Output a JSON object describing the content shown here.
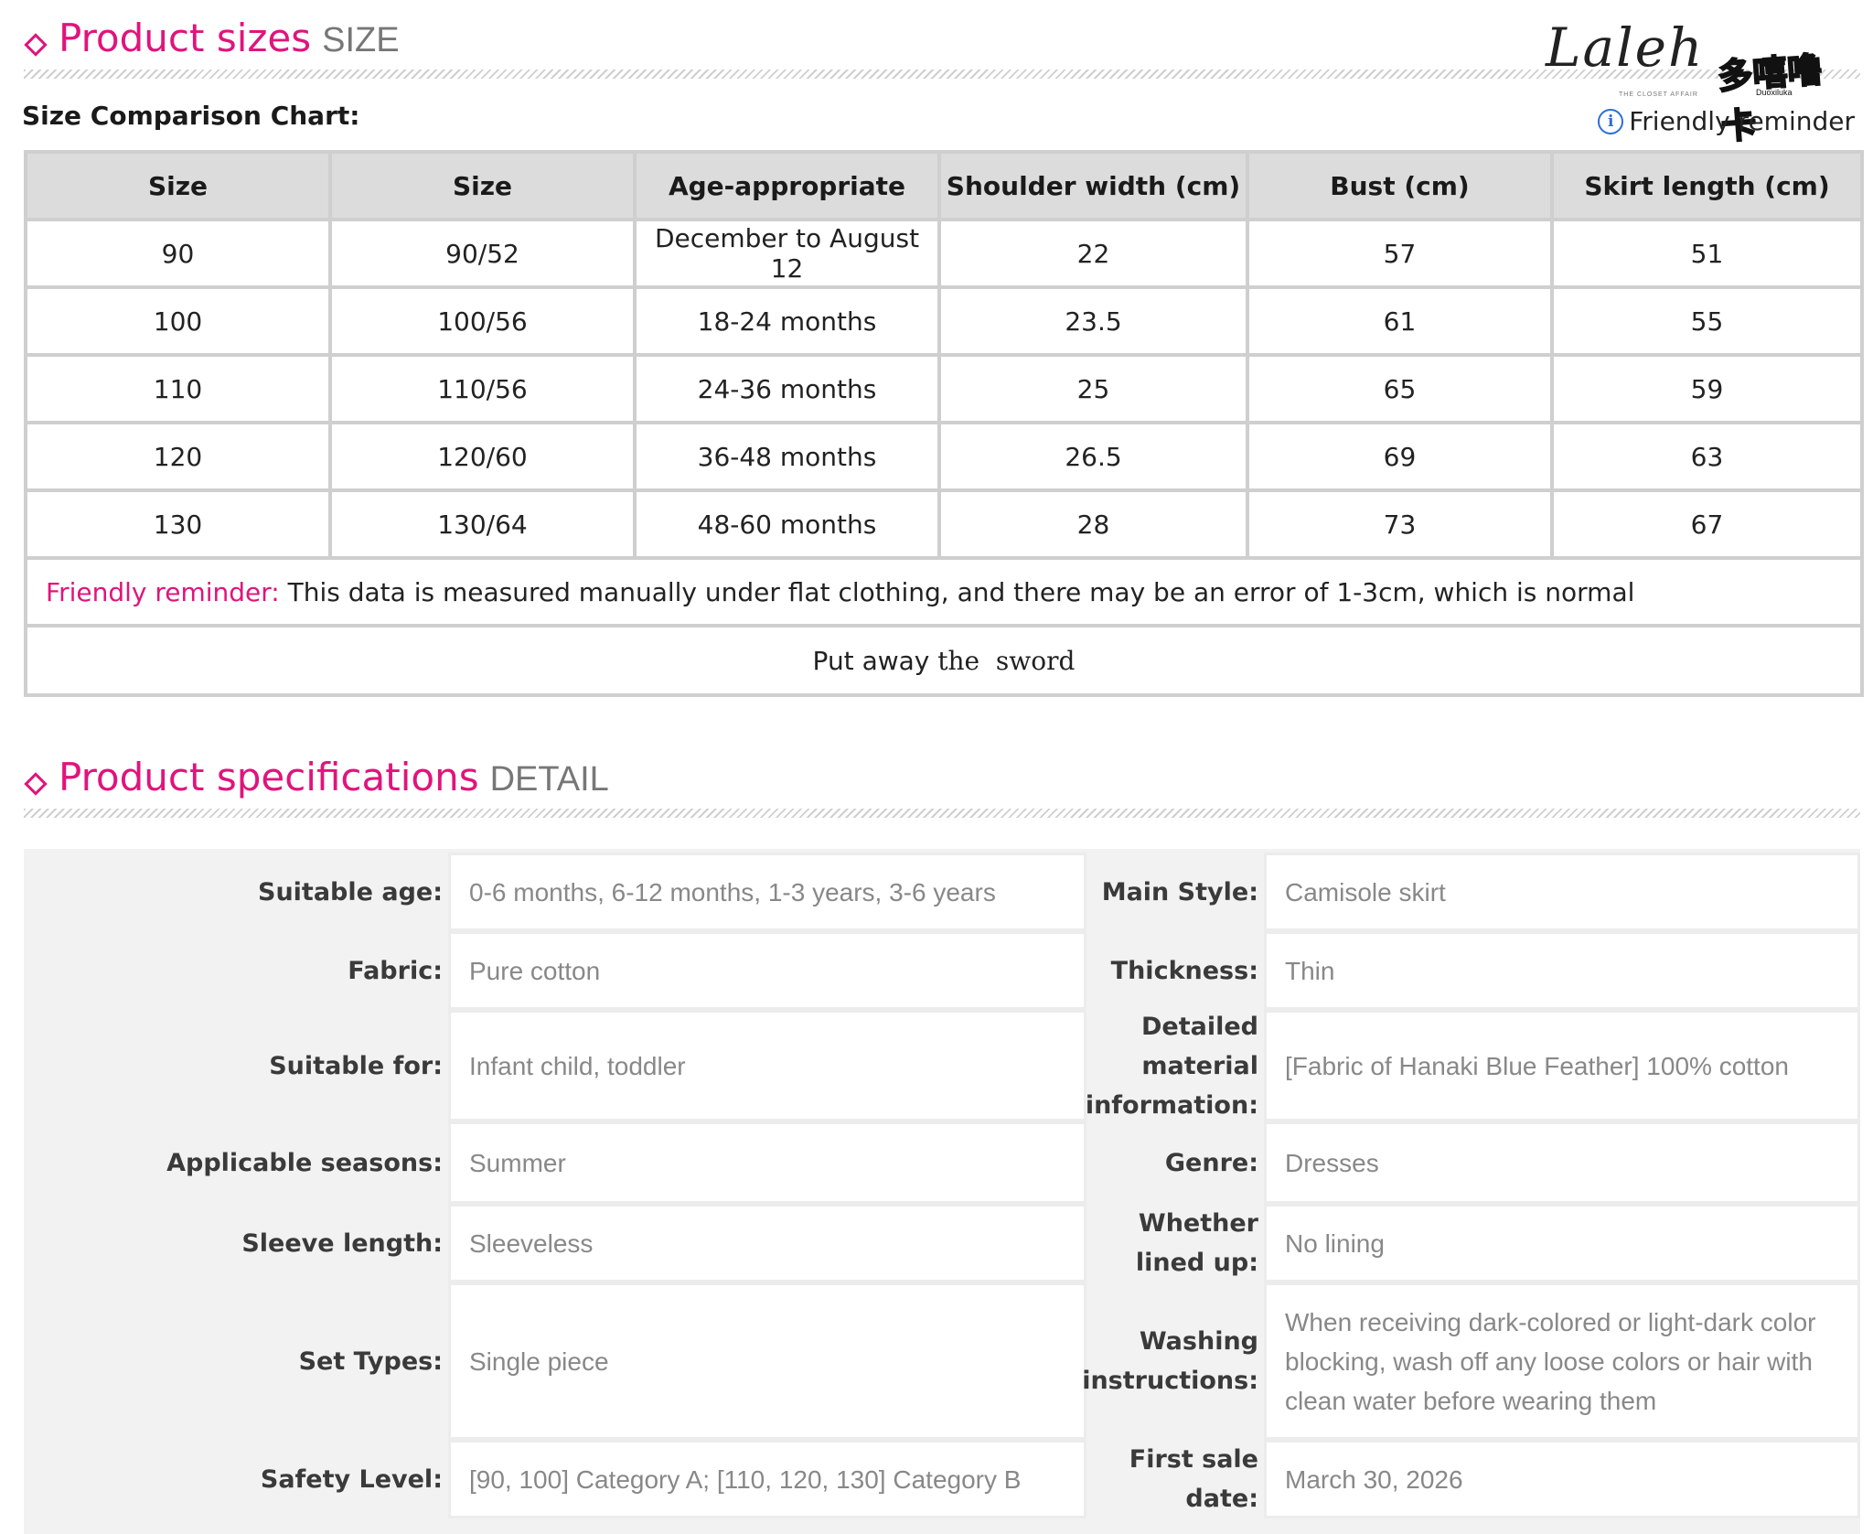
{
  "sizes_section": {
    "title": "Product sizes",
    "subtitle": "SIZE",
    "chart_label": "Size Comparison Chart:",
    "reminder_link": "Friendly reminder",
    "headers": [
      "Size",
      "Size",
      "Age-appropriate",
      "Shoulder width (cm)",
      "Bust (cm)",
      "Skirt length (cm)"
    ],
    "rows": [
      [
        "90",
        "90/52",
        "December to August 12",
        "22",
        "57",
        "51"
      ],
      [
        "100",
        "100/56",
        "18-24 months",
        "23.5",
        "61",
        "55"
      ],
      [
        "110",
        "110/56",
        "24-36 months",
        "25",
        "65",
        "59"
      ],
      [
        "120",
        "120/60",
        "36-48 months",
        "26.5",
        "69",
        "63"
      ],
      [
        "130",
        "130/64",
        "48-60 months",
        "28",
        "73",
        "67"
      ]
    ],
    "note_label": "Friendly reminder:",
    "note_text": " This data is measured manually under flat clothing, and there may be an error of 1-3cm, which is normal",
    "footer_a": "Put away",
    "footer_b": "the  sword"
  },
  "logo": {
    "script": "Laleh",
    "script_sub": "THE CLOSET AFFAIR",
    "badge": "多嘻噜卡",
    "badge_sub": "Duoxiluka"
  },
  "specs_section": {
    "title": "Product specifications",
    "subtitle": "DETAIL",
    "rows": [
      {
        "l_label": "Suitable age:",
        "l_value": "0-6 months, 6-12 months, 1-3 years, 3-6 years",
        "r_label": "Main Style:",
        "r_value": "Camisole skirt"
      },
      {
        "l_label": "Fabric:",
        "l_value": "Pure cotton",
        "r_label": "Thickness:",
        "r_value": "Thin"
      },
      {
        "l_label": "Suitable for:",
        "l_value": "Infant child, toddler",
        "r_label": "Detailed material information:",
        "r_value": "[Fabric of Hanaki Blue Feather] 100% cotton"
      },
      {
        "l_label": "Applicable seasons:",
        "l_value": "Summer",
        "r_label": "Genre:",
        "r_value": "Dresses"
      },
      {
        "l_label": "Sleeve length:",
        "l_value": "Sleeveless",
        "r_label": "Whether lined up:",
        "r_value": "No lining"
      },
      {
        "l_label": "Set Types:",
        "l_value": "Single piece",
        "r_label": "Washing instructions:",
        "r_value": "When receiving dark-colored or light-dark color blocking, wash off any loose colors or hair with clean water before wearing them"
      },
      {
        "l_label": "Safety Level:",
        "l_value": "[90, 100] Category A; [110, 120, 130] Category B",
        "r_label": "First sale date:",
        "r_value": "March 30, 2026"
      }
    ]
  }
}
